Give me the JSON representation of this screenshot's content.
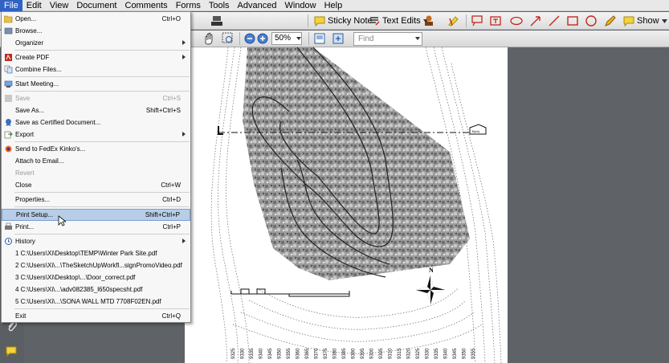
{
  "menubar": [
    "File",
    "Edit",
    "View",
    "Document",
    "Comments",
    "Forms",
    "Tools",
    "Advanced",
    "Window",
    "Help"
  ],
  "toolbar": {
    "sticky_note": "Sticky Note",
    "text_edits": "Text Edits",
    "show": "Show",
    "zoom": "50%",
    "find_placeholder": "Find"
  },
  "file_menu": {
    "open": {
      "label": "Open...",
      "shortcut": "Ctrl+O"
    },
    "browse": {
      "label": "Browse..."
    },
    "organizer": {
      "label": "Organizer"
    },
    "create_pdf": {
      "label": "Create PDF"
    },
    "combine": {
      "label": "Combine Files..."
    },
    "meeting": {
      "label": "Start Meeting..."
    },
    "save": {
      "label": "Save",
      "shortcut": "Ctrl+S"
    },
    "save_as": {
      "label": "Save As...",
      "shortcut": "Shift+Ctrl+S"
    },
    "save_certified": {
      "label": "Save as Certified Document..."
    },
    "export": {
      "label": "Export"
    },
    "fedex": {
      "label": "Send to FedEx Kinko's..."
    },
    "attach_email": {
      "label": "Attach to Email..."
    },
    "revert": {
      "label": "Revert"
    },
    "close": {
      "label": "Close",
      "shortcut": "Ctrl+W"
    },
    "properties": {
      "label": "Properties...",
      "shortcut": "Ctrl+D"
    },
    "print_setup": {
      "label": "Print Setup...",
      "shortcut": "Shift+Ctrl+P"
    },
    "print": {
      "label": "Print...",
      "shortcut": "Ctrl+P"
    },
    "history": {
      "label": "History"
    },
    "recent": [
      "1 C:\\Users\\Xi\\Desktop\\TEMP\\Winter Park Site.pdf",
      "2 C:\\Users\\Xi\\...\\TheSketchUpWorkfl...signPromoVideo.pdf",
      "3 C:\\Users\\Xi\\Desktop\\...\\Door_correct.pdf",
      "4 C:\\Users\\Xi\\...\\adv082385_l650specsht.pdf",
      "5 C:\\Users\\Xi\\...\\SONA WALL MTD 7708F02EN.pdf"
    ],
    "exit": {
      "label": "Exit",
      "shortcut": "Ctrl+Q"
    }
  },
  "drawing": {
    "north_label": "N",
    "section_tag": "B(xx)",
    "elevations": [
      "9325",
      "9330",
      "9335",
      "9340",
      "9345",
      "9350",
      "9355",
      "9360",
      "9365",
      "9370",
      "9375",
      "9380",
      "9385",
      "9390",
      "9395",
      "9300",
      "9305",
      "9310",
      "9315",
      "9320",
      "9325",
      "9330",
      "9335",
      "9340",
      "9345",
      "9350",
      "9355"
    ]
  },
  "colors": {
    "menu_active": "#3163c4",
    "menu_highlight": "#b7cde8",
    "doc_background": "#5f6367"
  }
}
